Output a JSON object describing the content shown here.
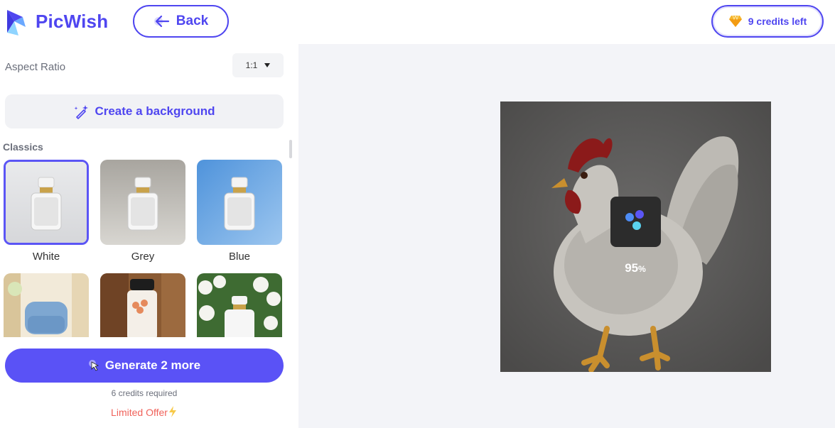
{
  "brand": {
    "name": "PicWish"
  },
  "header": {
    "back_label": "Back",
    "credits_label": "9 credits left"
  },
  "left": {
    "aspect_ratio_label": "Aspect Ratio",
    "aspect_ratio_value": "1:1",
    "create_background_label": "Create a background",
    "section_title": "Classics",
    "tiles": [
      {
        "label": "White",
        "selected": true
      },
      {
        "label": "Grey",
        "selected": false
      },
      {
        "label": "Blue",
        "selected": false
      },
      {
        "label": "",
        "selected": false
      },
      {
        "label": "",
        "selected": false
      },
      {
        "label": "",
        "selected": false
      }
    ],
    "generate_label": "Generate 2 more",
    "credits_required": "6 credits required",
    "limited_offer": "Limited Offer"
  },
  "preview": {
    "progress_value": "95",
    "progress_unit": "%"
  },
  "colors": {
    "accent": "#4f46f0",
    "button": "#5a52f6",
    "offer": "#f0625a"
  }
}
